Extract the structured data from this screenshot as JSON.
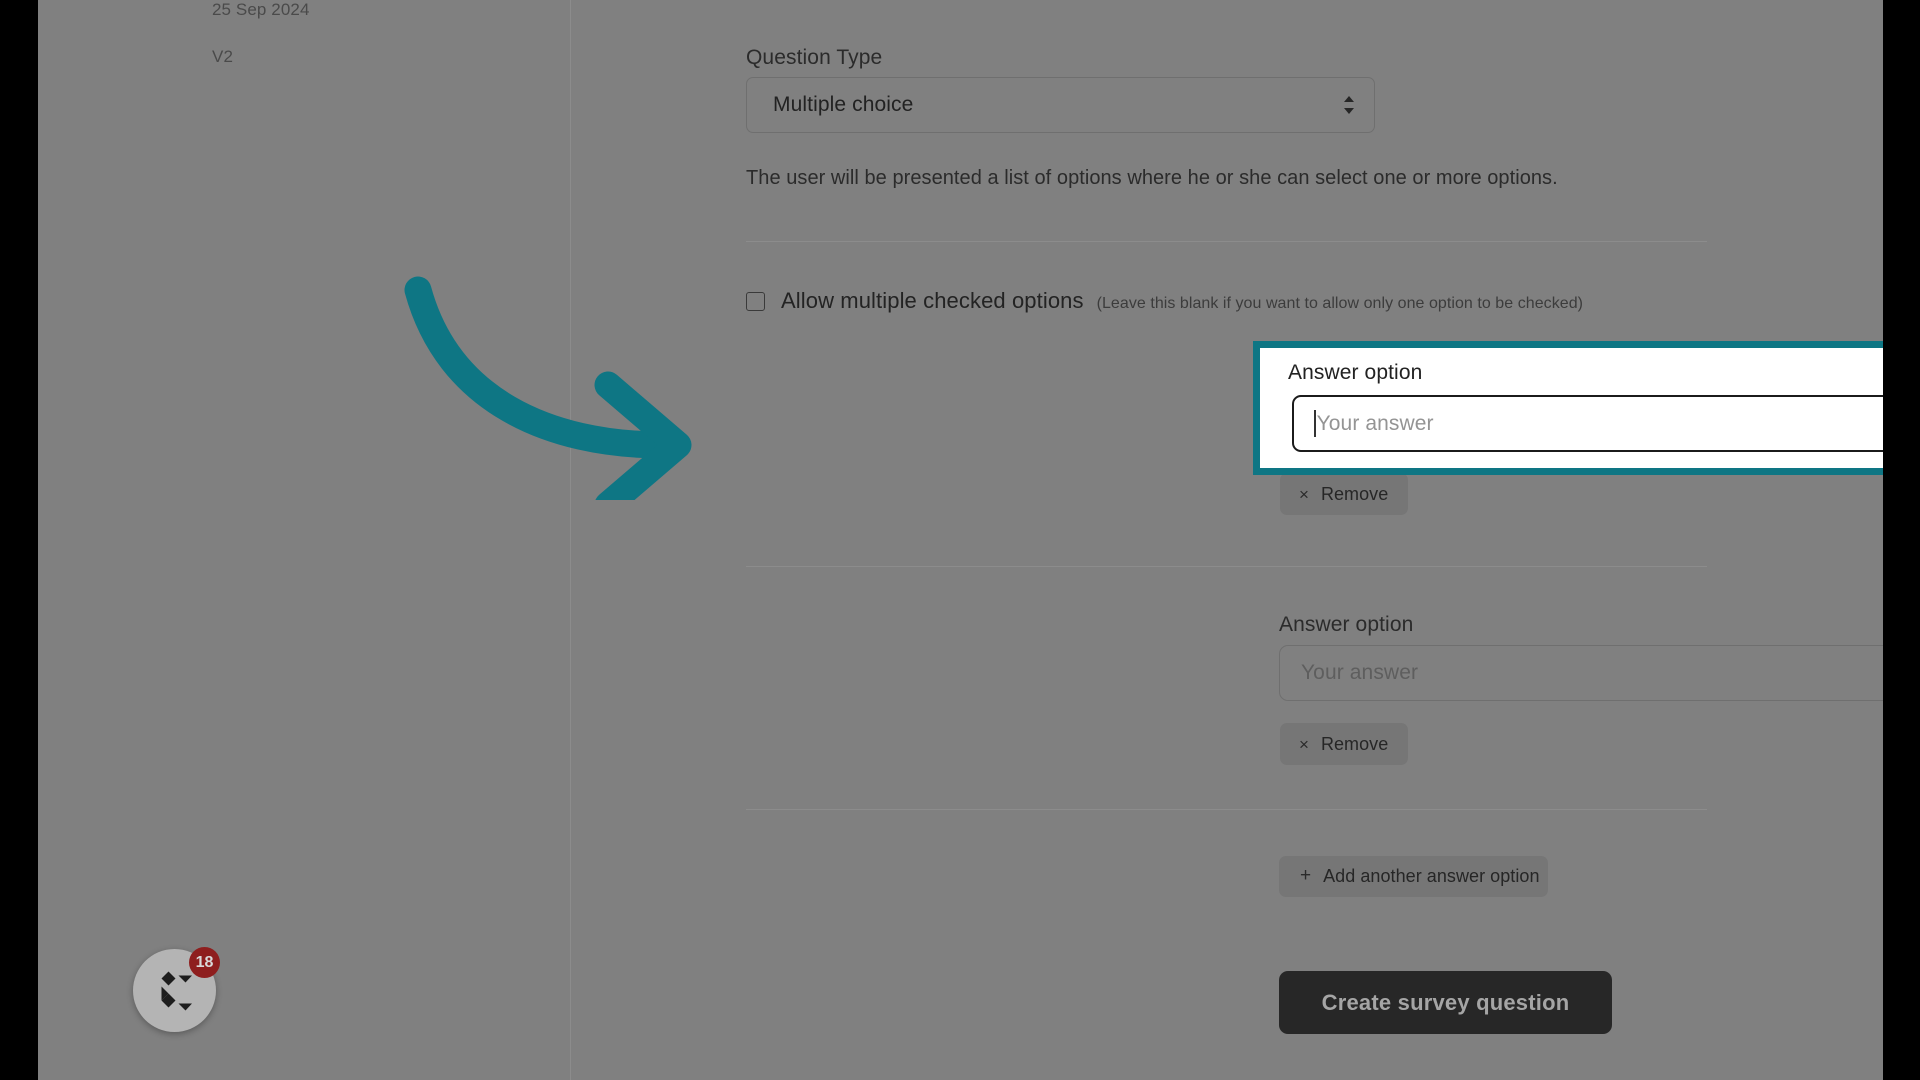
{
  "accent_color": "#0e7684",
  "left_rail": {
    "date": "25 Sep 2024",
    "version": "V2"
  },
  "chat_launcher": {
    "icon": "chat-logo-icon",
    "badge_count": "18"
  },
  "form": {
    "question_type": {
      "label": "Question Type",
      "value": "Multiple choice",
      "caret_icon": "select-updown-caret-icon",
      "help_text": "The user will be presented a list of options where he or she can select one or more options."
    },
    "allow_multiple": {
      "label": "Allow multiple checked options",
      "hint": "(Leave this blank if you want to allow only one option to be checked)",
      "checked": false
    },
    "answer_options": [
      {
        "label": "Answer option",
        "value": "",
        "placeholder": "Your answer",
        "focused": true,
        "remove_label": "Remove",
        "remove_icon": "close-x-icon"
      },
      {
        "label": "Answer option",
        "value": "",
        "placeholder": "Your answer",
        "focused": false,
        "remove_label": "Remove",
        "remove_icon": "close-x-icon"
      }
    ],
    "add_option": {
      "label": "Add another answer option",
      "icon": "plus-icon"
    },
    "submit": {
      "label": "Create survey question"
    }
  },
  "annotation": {
    "arrow_icon": "curved-arrow-right-icon",
    "color": "#0e7684"
  }
}
